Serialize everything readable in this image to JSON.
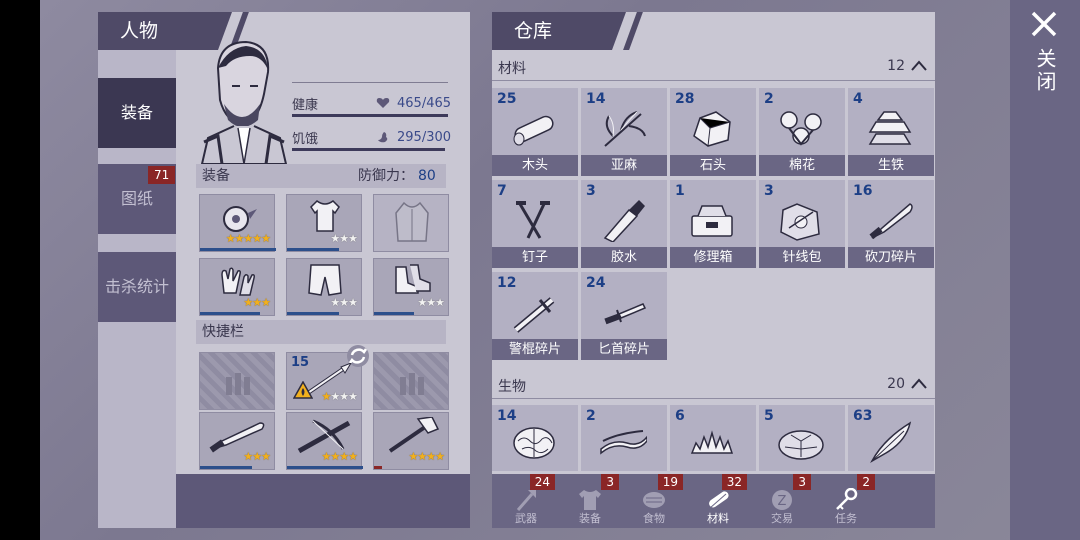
{
  "character": {
    "title": "人物",
    "tabs": [
      {
        "label": "装备"
      },
      {
        "label": "图纸",
        "badge": "71"
      },
      {
        "label": "击杀统计"
      }
    ],
    "stats": {
      "health_label": "健康",
      "health_value": "465/465",
      "health_fraction": 1.0,
      "hunger_label": "饥饿",
      "hunger_value": "295/300",
      "hunger_fraction": 0.98
    },
    "equipment_title": "装备",
    "defense_label": "防御力：",
    "defense_value": "80",
    "equipment_slots": [
      {
        "icon": "saw-blade-icon",
        "stars": 5,
        "max_stars": 5
      },
      {
        "icon": "shirt-icon",
        "stars": 0,
        "max_stars": 3
      },
      {
        "icon": "jacket-icon",
        "stars": null,
        "max_stars": null
      },
      {
        "icon": "gloves-icon",
        "stars": 3,
        "max_stars": 3
      },
      {
        "icon": "pants-icon",
        "stars": 0,
        "max_stars": 3
      },
      {
        "icon": "boots-icon",
        "stars": 0,
        "max_stars": 3
      }
    ],
    "quickbar_title": "快捷栏",
    "quickbar_slots": [
      {
        "icon": "locked-slot-icon"
      },
      {
        "icon": "spear-icon",
        "count": "15",
        "stars": 1,
        "max_stars": 4
      },
      {
        "icon": "locked-slot-icon"
      },
      {
        "icon": "machete-icon",
        "stars": 3,
        "max_stars": 3
      },
      {
        "icon": "crossbow-icon",
        "stars": 4,
        "max_stars": 4
      },
      {
        "icon": "axe-icon",
        "stars": 4,
        "max_stars": 4
      }
    ]
  },
  "warehouse": {
    "title": "仓库",
    "categories": [
      {
        "name": "材料",
        "count": "12",
        "items": [
          {
            "count": "25",
            "label": "木头",
            "icon": "log-icon"
          },
          {
            "count": "14",
            "label": "亚麻",
            "icon": "flax-icon"
          },
          {
            "count": "28",
            "label": "石头",
            "icon": "stone-icon"
          },
          {
            "count": "2",
            "label": "棉花",
            "icon": "cotton-icon"
          },
          {
            "count": "4",
            "label": "生铁",
            "icon": "iron-ingot-icon"
          },
          {
            "count": "7",
            "label": "钉子",
            "icon": "nails-icon"
          },
          {
            "count": "3",
            "label": "胶水",
            "icon": "glue-icon"
          },
          {
            "count": "1",
            "label": "修理箱",
            "icon": "repair-kit-icon"
          },
          {
            "count": "3",
            "label": "针线包",
            "icon": "sewing-kit-icon"
          },
          {
            "count": "16",
            "label": "砍刀碎片",
            "icon": "machete-fragment-icon"
          },
          {
            "count": "12",
            "label": "警棍碎片",
            "icon": "baton-fragment-icon"
          },
          {
            "count": "24",
            "label": "匕首碎片",
            "icon": "dagger-fragment-icon"
          }
        ]
      },
      {
        "name": "生物",
        "count": "20",
        "items": [
          {
            "count": "14",
            "label": "",
            "icon": "brain-icon"
          },
          {
            "count": "2",
            "label": "",
            "icon": "leather-strip-icon"
          },
          {
            "count": "6",
            "label": "",
            "icon": "fur-icon"
          },
          {
            "count": "5",
            "label": "",
            "icon": "turtle-shell-icon"
          },
          {
            "count": "63",
            "label": "",
            "icon": "feather-icon"
          }
        ]
      }
    ],
    "bottom_tabs": [
      {
        "label": "武器",
        "badge": "24",
        "icon": "axe-tab-icon"
      },
      {
        "label": "装备",
        "badge": "3",
        "icon": "shirt-tab-icon"
      },
      {
        "label": "食物",
        "badge": "19",
        "icon": "meat-tab-icon"
      },
      {
        "label": "材料",
        "badge": "32",
        "icon": "log-tab-icon",
        "active": true
      },
      {
        "label": "交易",
        "badge": "3",
        "icon": "coin-tab-icon"
      },
      {
        "label": "任务",
        "badge": "2",
        "icon": "key-tab-icon"
      }
    ]
  },
  "close_label": "关闭"
}
